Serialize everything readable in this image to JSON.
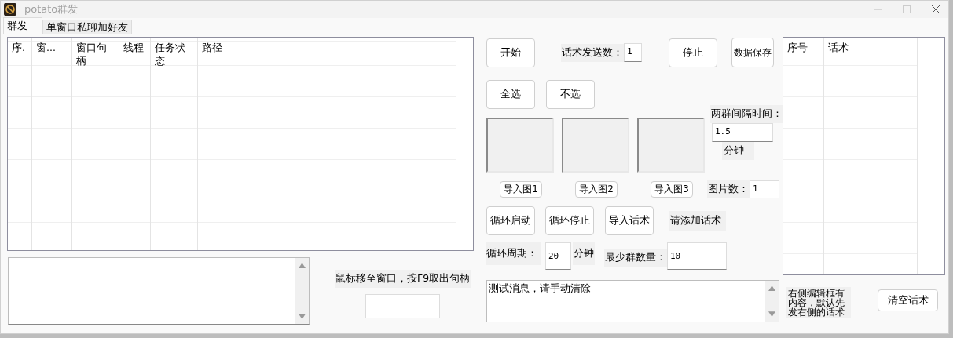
{
  "window": {
    "title": "potato群发"
  },
  "tabs": [
    {
      "label": "群发",
      "selected": true
    },
    {
      "label": "单窗口私聊加好友",
      "selected": false
    }
  ],
  "task_table": {
    "columns": [
      "序.",
      "窗...",
      "窗口句柄",
      "线程",
      "任务状态",
      "路径"
    ]
  },
  "handle_hint": "鼠标移至窗口，按F9取出句柄",
  "start_button": "开始",
  "send_count": {
    "label": "话术发送数：",
    "value": "1"
  },
  "stop_button": "停止",
  "save_button": "数据保存",
  "select_all_button": "全选",
  "select_none_button": "不选",
  "interval": {
    "label": "两群间隔时间：",
    "value": "1.5",
    "unit": "分钟"
  },
  "image_buttons": [
    "导入图1",
    "导入图2",
    "导入图3"
  ],
  "image_count": {
    "label": "图片数：",
    "value": "1"
  },
  "loop_start_button": "循环启动",
  "loop_stop_button": "循环停止",
  "import_scripts_button": "导入话术",
  "scripts_status": "请添加话术",
  "cycle": {
    "label": "循环周期：",
    "value": "20",
    "unit": "分钟"
  },
  "min_groups": {
    "label": "最少群数量：",
    "value": "10"
  },
  "message_box": {
    "value": "测试消息，请手动清除"
  },
  "script_table": {
    "columns": [
      "序号",
      "话术"
    ]
  },
  "script_note": "右侧编辑框有内容，默认先发右侧的话术",
  "clear_scripts_button": "清空话术"
}
